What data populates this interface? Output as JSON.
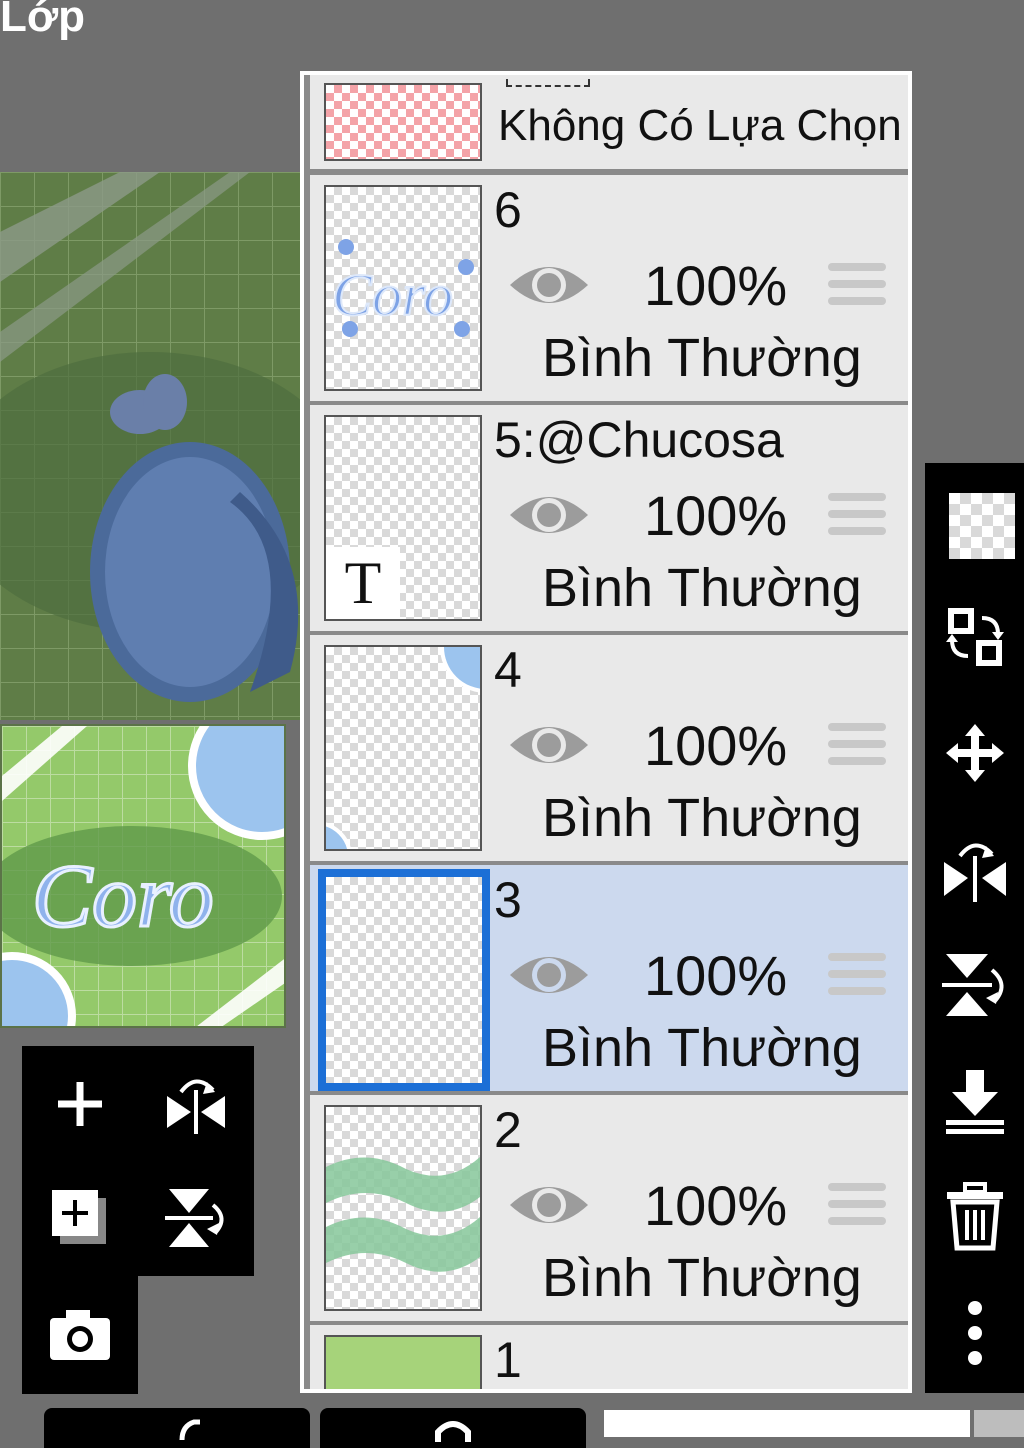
{
  "header": {
    "title": "Lớp"
  },
  "layers": {
    "selection_layer": {
      "label": "Không Có Lựa Chọn"
    },
    "items": [
      {
        "name": "6",
        "opacity": "100%",
        "blend": "Bình Thường",
        "visible": true,
        "selected": false
      },
      {
        "name": "5:@Chucosa",
        "opacity": "100%",
        "blend": "Bình Thường",
        "visible": true,
        "selected": false
      },
      {
        "name": "4",
        "opacity": "100%",
        "blend": "Bình Thường",
        "visible": true,
        "selected": false
      },
      {
        "name": "3",
        "opacity": "100%",
        "blend": "Bình Thường",
        "visible": true,
        "selected": true
      },
      {
        "name": "2",
        "opacity": "100%",
        "blend": "Bình Thường",
        "visible": true,
        "selected": false
      },
      {
        "name": "1"
      }
    ],
    "text_layer_glyph": "T"
  },
  "left_tools": [
    "add-layer-icon",
    "flip-horizontal-icon",
    "new-layer-icon",
    "flip-vertical-icon",
    "camera-icon"
  ],
  "right_tools": [
    "transparency-icon",
    "swap-layer-icon",
    "move-icon",
    "flip-horizontal-icon",
    "flip-vertical-icon",
    "merge-down-icon",
    "trash-icon",
    "more-icon"
  ],
  "colors": {
    "selected_row": "#ccd9ee",
    "selected_border": "#1c6fd6",
    "panel_bg": "#e9e9e9",
    "background": "#6f6f6f"
  }
}
